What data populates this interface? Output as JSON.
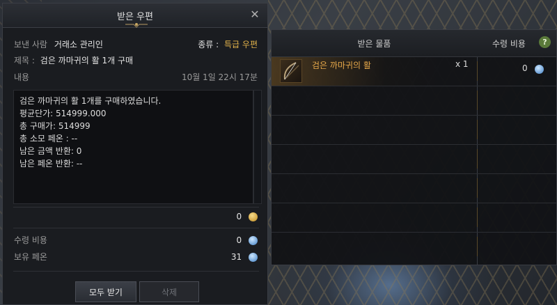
{
  "mail": {
    "title": "받은 우편",
    "sender_label": "보낸 사람",
    "sender": "거래소 관리인",
    "type_label": "종류 :",
    "type_value": "특급 우편",
    "subject_label": "제목 :",
    "subject": "검은 까마귀의 활 1개 구매",
    "content_label": "내용",
    "date": "10월 1일 22시 17분",
    "body_lines": [
      "검은 까마귀의 활 1개를 구매하였습니다.",
      "",
      "평균단가: 514999.000",
      "총 구매가: 514999",
      "총 소모 페온 : --",
      "",
      "남은 금액 반환: 0",
      "남은 페온 반환: --"
    ],
    "attached_gold": "0",
    "fee_label": "수령 비용",
    "fee_value": "0",
    "owned_label": "보유 페온",
    "owned_value": "31",
    "receive_all_button": "모두 받기",
    "delete_button": "삭제"
  },
  "items_panel": {
    "header_item": "받은 물품",
    "header_cost": "수령 비용",
    "help_icon": "?",
    "items": [
      {
        "name": "검은 까마귀의 활",
        "qty": "x 1",
        "cost": "0"
      }
    ]
  },
  "colors": {
    "accent_gold": "#e0b14a",
    "item_orange": "#e8a94a"
  }
}
